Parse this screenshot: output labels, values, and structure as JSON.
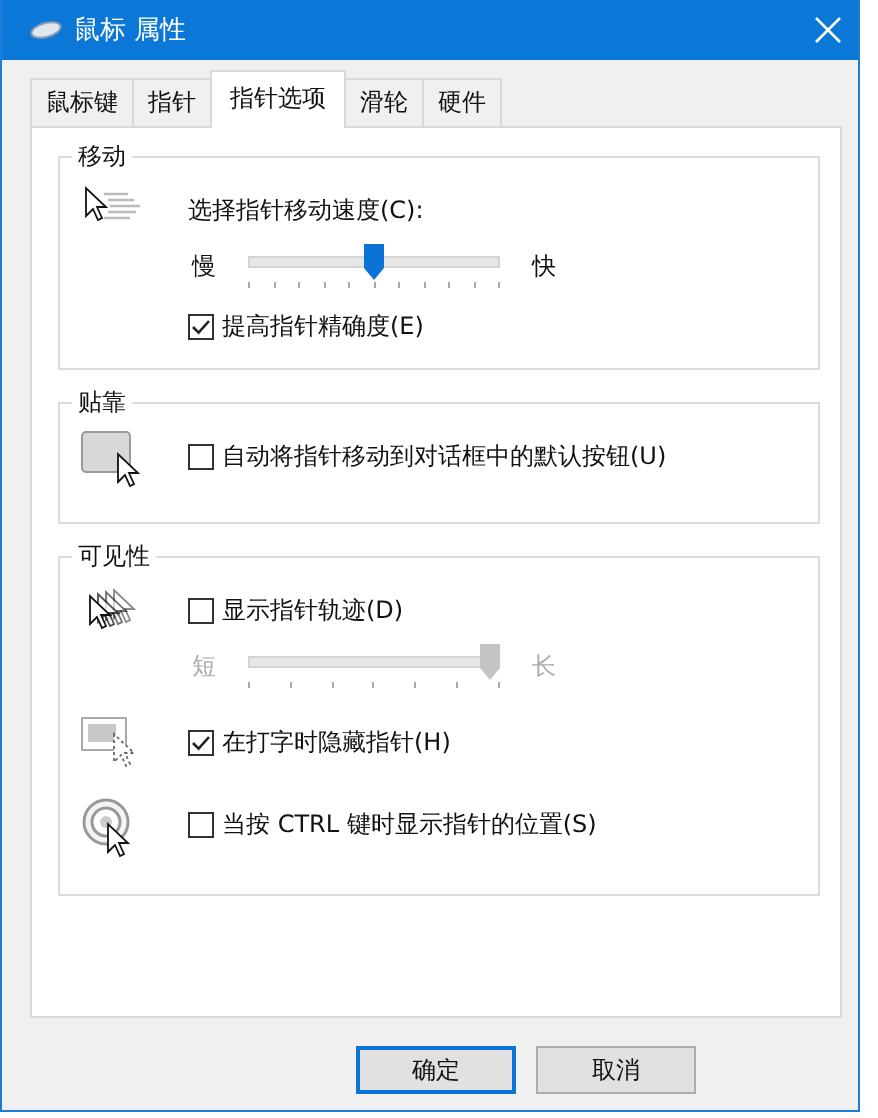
{
  "window": {
    "title": "鼠标 属性"
  },
  "tabs": [
    {
      "label": "鼠标键",
      "selected": false
    },
    {
      "label": "指针",
      "selected": false
    },
    {
      "label": "指针选项",
      "selected": true
    },
    {
      "label": "滑轮",
      "selected": false
    },
    {
      "label": "硬件",
      "selected": false
    }
  ],
  "groups": [
    {
      "title": "移动",
      "blocks": [
        {
          "items": [
            {
              "kind": "label",
              "text": "选择指针移动速度(C):"
            },
            {
              "kind": "slider",
              "min_label": "慢",
              "max_label": "快",
              "level": 0.5,
              "disabled": false
            },
            {
              "kind": "checkbox",
              "label": "提高指针精确度(E)",
              "checked": true
            }
          ]
        }
      ]
    },
    {
      "title": "贴靠",
      "blocks": [
        {
          "items": [
            {
              "kind": "checkbox",
              "label": "自动将指针移动到对话框中的默认按钮(U)",
              "checked": false
            }
          ]
        }
      ]
    },
    {
      "title": "可见性",
      "blocks": [
        {
          "items": [
            {
              "kind": "checkbox",
              "label": "显示指针轨迹(D)",
              "checked": false
            },
            {
              "kind": "slider",
              "min_label": "短",
              "max_label": "长",
              "level": 1,
              "disabled": true
            }
          ]
        },
        {
          "items": [
            {
              "kind": "checkbox",
              "label": "在打字时隐藏指针(H)",
              "checked": true
            }
          ]
        },
        {
          "items": [
            {
              "kind": "checkbox",
              "label": "当按 CTRL 键时显示指针的位置(S)",
              "checked": false
            }
          ]
        }
      ]
    }
  ],
  "buttons": [
    {
      "label": "确定",
      "default": true
    },
    {
      "label": "取消",
      "default": false
    }
  ]
}
